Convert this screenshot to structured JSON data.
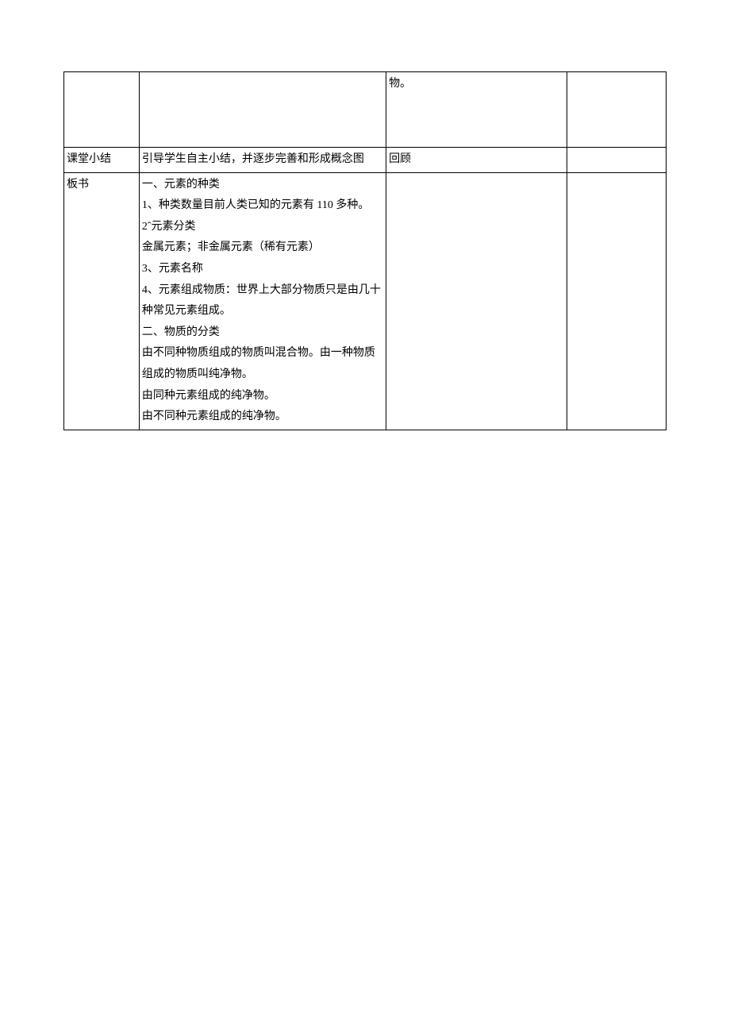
{
  "table": {
    "row1": {
      "c1": "",
      "c2": "",
      "c3": "物。",
      "c4": ""
    },
    "row2": {
      "c1": "课堂小结",
      "c2": "引导学生自主小结，并逐步完善和形成概念图",
      "c3": "回顾",
      "c4": ""
    },
    "row3": {
      "c1": "板书",
      "c2": "一、元素的种类\n1、种类数量目前人类已知的元素有 110 多种。\n2ˆ元素分类\n金属元素；非金属元素（稀有元素）\n3、元素名称\n4、元素组成物质：世界上大部分物质只是由几十种常见元素组成。\n二、物质的分类\n由不同种物质组成的物质叫混合物。由一种物质组成的物质叫纯净物。\n由同种元素组成的纯净物。\n由不同种元素组成的纯净物。",
      "c3": "",
      "c4": ""
    }
  }
}
